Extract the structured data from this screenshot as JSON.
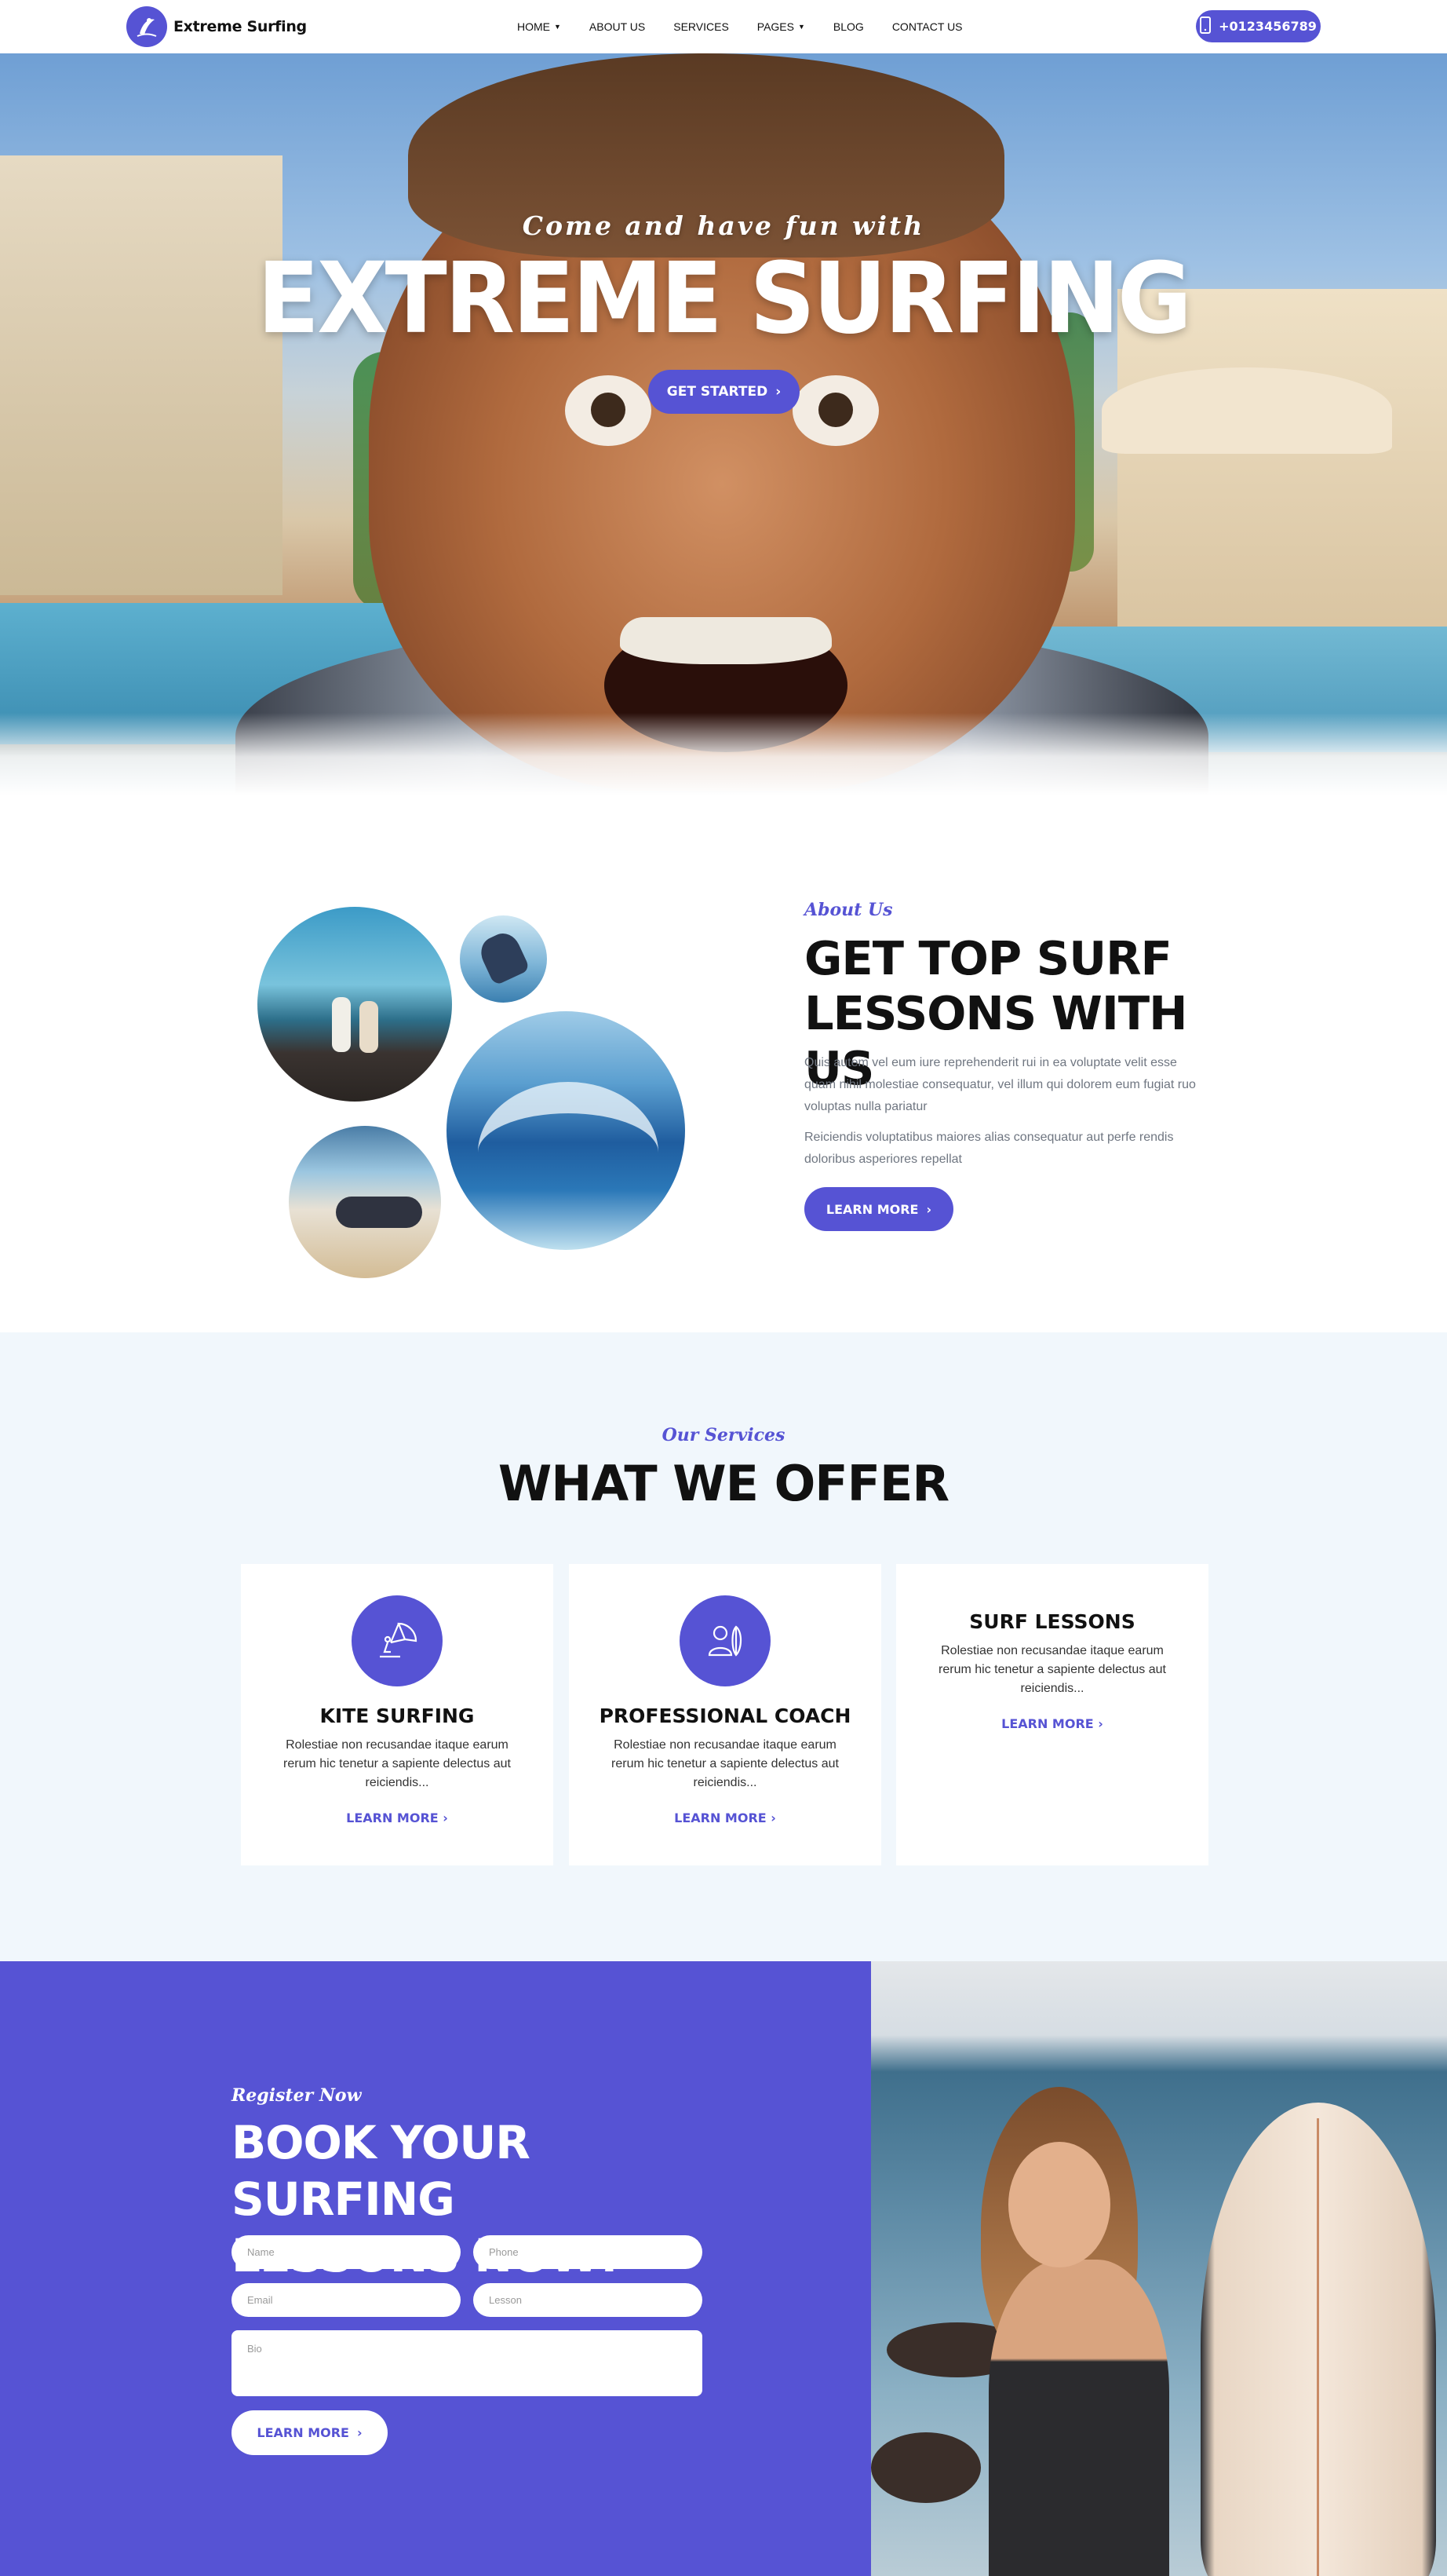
{
  "nav": {
    "logo_text": "Extreme Surfing",
    "menu": [
      {
        "label": "HOME",
        "has_dropdown": true
      },
      {
        "label": "ABOUT US",
        "has_dropdown": false
      },
      {
        "label": "SERVICES",
        "has_dropdown": false
      },
      {
        "label": "PAGES",
        "has_dropdown": true
      },
      {
        "label": "BLOG",
        "has_dropdown": false
      },
      {
        "label": "CONTACT US",
        "has_dropdown": false
      }
    ],
    "phone": "+0123456789",
    "phone_icon": "mobile-phone-icon"
  },
  "hero": {
    "kicker": "Come and have fun with",
    "title": "EXTREME SURFING",
    "button": "GET STARTED"
  },
  "about": {
    "kicker": "About Us",
    "title_line1": "GET TOP SURF",
    "title_line2": "LESSONS WITH US",
    "paragraph1": "Quis autem vel eum iure reprehenderit rui in ea voluptate velit esse quam nihil molestiae consequatur, vel illum qui dolorem eum fugiat ruo voluptas nulla pariatur",
    "paragraph2": "Reiciendis voluptatibus maiores alias consequatur aut perfe rendis doloribus asperiores repellat",
    "button": "LEARN MORE"
  },
  "services": {
    "kicker": "Our Services",
    "title": "WHAT WE OFFER",
    "cards": [
      {
        "title": "KITE SURFING",
        "icon": "kite-surfer-icon",
        "description": "Rolestiae non recusandae itaque earum rerum hic tenetur a sapiente delectus aut reiciendis...",
        "link": "LEARN MORE"
      },
      {
        "title": "PROFESSIONAL COACH",
        "icon": "coach-with-surfboard-icon",
        "description": "Rolestiae non recusandae itaque earum rerum hic tenetur a sapiente delectus aut reiciendis...",
        "link": "LEARN MORE"
      },
      {
        "title": "SURF LESSONS",
        "icon": "",
        "description": "Rolestiae non recusandae itaque earum rerum hic tenetur a sapiente delectus aut reiciendis...",
        "link": "LEARN MORE"
      }
    ]
  },
  "register": {
    "kicker": "Register Now",
    "title_line1": "BOOK YOUR SURFING",
    "title_line2": "LESSONS NOW!",
    "placeholders": {
      "name": "Name",
      "phone": "Phone",
      "email": "Email",
      "lesson": "Lesson",
      "bio": "Bio"
    },
    "button": "LEARN MORE"
  },
  "colors": {
    "accent": "#5653d4",
    "services_bg": "#f1f7fc",
    "text_dark": "#111111",
    "text_muted": "#6f7681"
  }
}
